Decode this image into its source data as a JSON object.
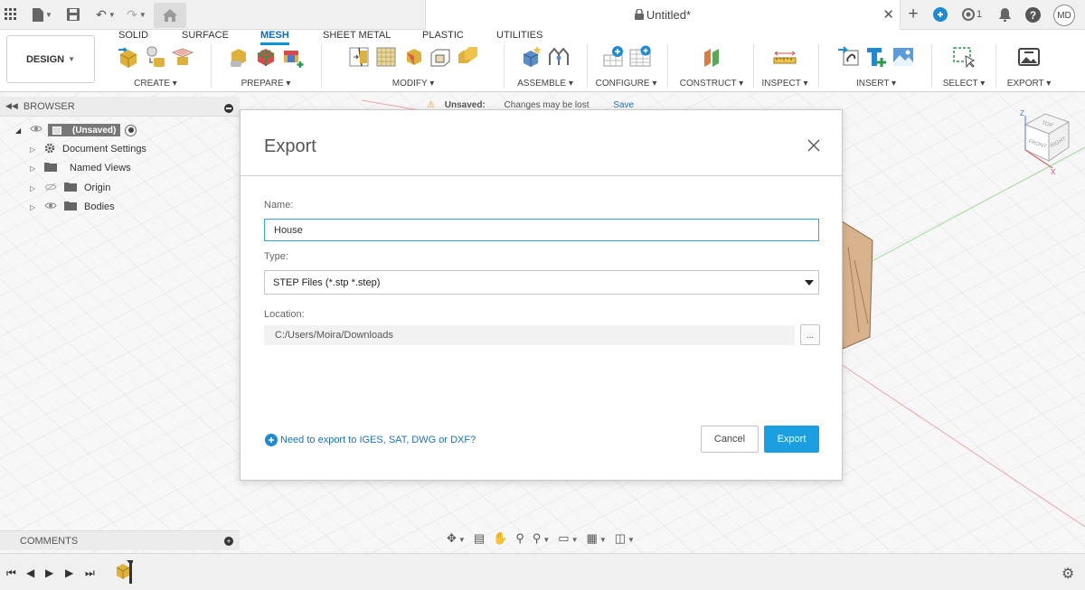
{
  "titlebar": {
    "doc_title": "Untitled*",
    "job_count": "1",
    "user_initials": "MD"
  },
  "ribbon": {
    "workspace": "DESIGN",
    "tabs": [
      "SOLID",
      "SURFACE",
      "MESH",
      "SHEET METAL",
      "PLASTIC",
      "UTILITIES"
    ],
    "active_tab": "MESH",
    "groups": [
      "CREATE",
      "PREPARE",
      "MODIFY",
      "ASSEMBLE",
      "CONFIGURE",
      "CONSTRUCT",
      "INSPECT",
      "INSERT",
      "SELECT",
      "EXPORT"
    ]
  },
  "browser": {
    "header": "BROWSER",
    "root": "(Unsaved)",
    "items": [
      "Document Settings",
      "Named Views",
      "Origin",
      "Bodies"
    ]
  },
  "banner": {
    "status": "Unsaved:",
    "message": "Changes may be lost",
    "action": "Save"
  },
  "comments": {
    "label": "COMMENTS"
  },
  "viewcube": {
    "top": "TOP",
    "front": "FRONT",
    "right": "RIGHT",
    "axis_z": "Z",
    "axis_x": "X"
  },
  "dialog": {
    "title": "Export",
    "name_label": "Name:",
    "name_value": "House",
    "type_label": "Type:",
    "type_value": "STEP Files (*.stp *.step)",
    "location_label": "Location:",
    "location_value": "C:/Users/Moira/Downloads",
    "browse_label": "...",
    "help_link": "Need to export to IGES, SAT, DWG or DXF?",
    "cancel_label": "Cancel",
    "export_label": "Export"
  },
  "colors": {
    "accent": "#0696d7",
    "primary_button": "#1b9fe0",
    "link": "#1b73b9",
    "model": "#d7b28c"
  }
}
